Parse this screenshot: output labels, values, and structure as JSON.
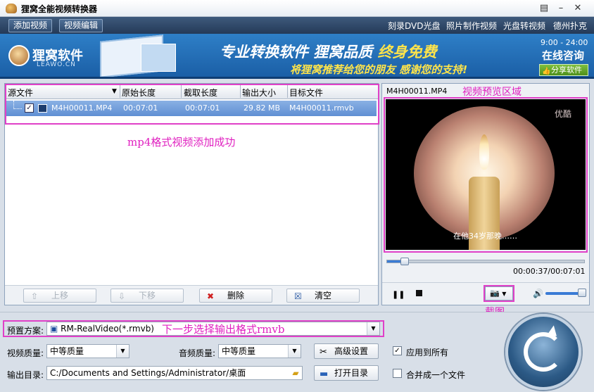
{
  "window": {
    "title": "狸窝全能视频转换器",
    "controls": {
      "menu": "▤",
      "minimize": "–",
      "close": "✕"
    }
  },
  "toolbar": {
    "add_video": "添加视频",
    "edit_video": "视频编辑",
    "links": [
      "刻录DVD光盘",
      "照片制作视频",
      "光盘转视频",
      "德州扑克"
    ]
  },
  "banner": {
    "logo_text": "狸窝软件",
    "logo_sub": "LEAWO.CN",
    "slogan_a": "专业转换软件 狸窝品质 ",
    "slogan_b": "终身免费",
    "slogan2": "将狸窝推荐给您的朋友 感谢您的支持!",
    "hours": "9:00 - 24:00",
    "consult": "在线咨询",
    "share": "分享软件"
  },
  "file_list": {
    "columns": [
      "源文件",
      "原始长度",
      "截取长度",
      "输出大小",
      "目标文件"
    ],
    "rows": [
      {
        "checked": "✓",
        "source": "M4H00011.MP4",
        "original_length": "00:07:01",
        "clip_length": "00:07:01",
        "output_size": "29.82 MB",
        "target": "M4H00011.rmvb"
      }
    ],
    "annotation": "mp4格式视频添加成功",
    "buttons": {
      "move_up": "上移",
      "move_down": "下移",
      "delete": "删除",
      "clear": "清空"
    }
  },
  "preview": {
    "file_name": "M4H00011.MP4",
    "annotation": "视频预览区域",
    "watermark": "优酷",
    "subtitle": "在他34岁那晚……",
    "time": "00:00:37/00:07:01",
    "progress_fraction": 0.088,
    "volume_fraction": 0.9,
    "snapshot_annotation": "截图"
  },
  "settings": {
    "preset_label": "预置方案:",
    "preset_value": "RM-RealVideo(*.rmvb)",
    "preset_annotation": "下一步选择输出格式rmvb",
    "video_quality_label": "视频质量:",
    "video_quality_value": "中等质量",
    "audio_quality_label": "音频质量:",
    "audio_quality_value": "中等质量",
    "advanced_button": "高级设置",
    "apply_all_label": "应用到所有",
    "apply_all_checked": "✓",
    "output_dir_label": "输出目录:",
    "output_dir_value": "C:/Documents and Settings/Administrator/桌面",
    "open_dir_button": "打开目录",
    "merge_label": "合并成一个文件"
  },
  "colors": {
    "annotation": "#e020c0",
    "selected_row": "#6f9bd9",
    "toolbar": "#2f4a6d"
  }
}
